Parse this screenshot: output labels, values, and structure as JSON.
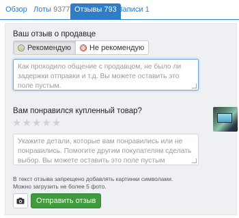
{
  "tabs": [
    {
      "label": "Обзор",
      "count": ""
    },
    {
      "label": "Лоты",
      "count": "9377"
    },
    {
      "label": "Отзывы",
      "count": "793"
    },
    {
      "label": "Записи",
      "count": "1"
    }
  ],
  "seller": {
    "heading": "Ваш отзыв о продавце",
    "recommend_label": "Рекомендую",
    "not_recommend_label": "Не рекомендую",
    "selected": "recommend",
    "placeholder": "Как проходило общение с продавцом, не было ли задержки отправки и т.д. Вы можете оставить это поле пустым."
  },
  "product": {
    "heading": "Вам понравился купленный товар?",
    "rating": 0,
    "max_rating": 5,
    "placeholder": "Укажите детали, которые вам понравились или не понравились. Помогите другим покупателям сделать выбор. Вы можете оставить это поле пустым"
  },
  "note_lines": [
    "В текст отзыва запрещено добавлять картинки символами.",
    "Можно загрузить не более 5 фото."
  ],
  "submit_label": "Отправить отзыв",
  "colors": {
    "accent": "#2e7dc6",
    "submit": "#3e9a3a"
  },
  "icons": {
    "camera": "camera-icon",
    "smile": "smile-icon",
    "frown": "frown-icon",
    "star": "star-icon"
  }
}
